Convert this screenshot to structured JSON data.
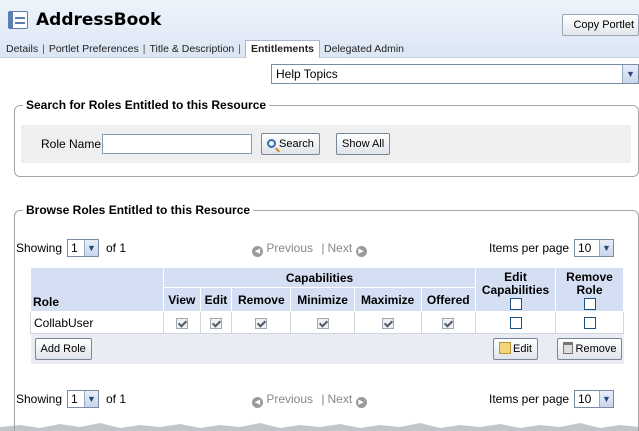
{
  "header": {
    "title": "AddressBook",
    "icon": "address-book-icon",
    "copy_button": "Copy Portlet"
  },
  "tabs": [
    {
      "label": "Details",
      "active": false
    },
    {
      "label": "Portlet Preferences",
      "active": false
    },
    {
      "label": "Title & Description",
      "active": false
    },
    {
      "label": "Entitlements",
      "active": true
    },
    {
      "label": "Delegated Admin",
      "active": false
    }
  ],
  "help": {
    "selected": "Help Topics"
  },
  "search": {
    "legend": "Search for Roles Entitled to this Resource",
    "role_label": "Role Name",
    "role_value": "",
    "search_button": "Search",
    "show_all_button": "Show All"
  },
  "browse": {
    "legend": "Browse Roles Entitled to this Resource",
    "pager": {
      "showing_label": "Showing",
      "page": "1",
      "of_label": "of 1",
      "previous": "Previous",
      "separator": "|",
      "next": "Next",
      "items_per_page_label": "Items per page",
      "items_per_page": "10"
    },
    "table": {
      "header_role": "Role",
      "header_capabilities": "Capabilities",
      "capabilities": [
        "View",
        "Edit",
        "Remove",
        "Minimize",
        "Maximize",
        "Offered"
      ],
      "header_edit_capabilities": "Edit Capabilities",
      "header_remove_role": "Remove Role",
      "rows": [
        {
          "role": "CollabUser",
          "checks": [
            true,
            true,
            true,
            true,
            true,
            true
          ],
          "edit_capabilities": false,
          "remove_role": false
        }
      ],
      "add_role_button": "Add Role",
      "edit_button": "Edit",
      "remove_button": "Remove"
    }
  },
  "colors": {
    "header_bg": "#dbe6f4",
    "table_header": "#d5dff3",
    "accent": "#1c5180"
  }
}
